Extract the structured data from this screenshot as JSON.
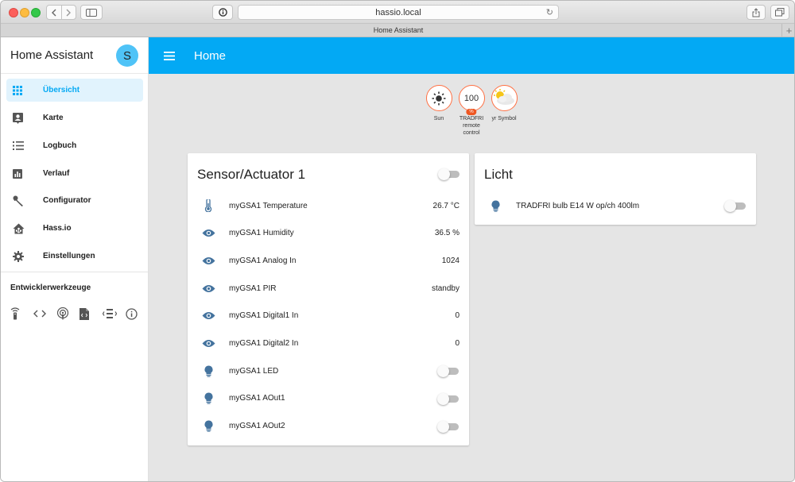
{
  "browser": {
    "url": "hassio.local",
    "tab_title": "Home Assistant"
  },
  "sidebar": {
    "title": "Home Assistant",
    "avatar_initial": "S",
    "items": [
      {
        "label": "Übersicht",
        "icon": "grid-icon",
        "active": true
      },
      {
        "label": "Karte",
        "icon": "map-account-icon"
      },
      {
        "label": "Logbuch",
        "icon": "list-icon"
      },
      {
        "label": "Verlauf",
        "icon": "chart-icon"
      },
      {
        "label": "Configurator",
        "icon": "wrench-icon"
      },
      {
        "label": "Hass.io",
        "icon": "home-assistant-icon"
      },
      {
        "label": "Einstellungen",
        "icon": "gear-icon"
      }
    ],
    "dev_tools_title": "Entwicklerwerkzeuge",
    "dev_tools": [
      "remote-icon",
      "code-icon",
      "podcast-icon",
      "file-xml-icon",
      "radio-tower-icon",
      "info-icon"
    ]
  },
  "header": {
    "title": "Home"
  },
  "badges": [
    {
      "label": "Sun",
      "value": "",
      "icon": "sun-icon"
    },
    {
      "label": "TRADFRI remote control",
      "value": "100",
      "unit": "%"
    },
    {
      "label": "yr Symbol",
      "value": "",
      "icon": "weather-icon"
    }
  ],
  "cards": {
    "sensor": {
      "title": "Sensor/Actuator 1",
      "rows": [
        {
          "name": "myGSA1 Temperature",
          "value": "26.7 °C",
          "icon": "thermometer-icon"
        },
        {
          "name": "myGSA1 Humidity",
          "value": "36.5 %",
          "icon": "eye-icon"
        },
        {
          "name": "myGSA1 Analog In",
          "value": "1024",
          "icon": "eye-icon"
        },
        {
          "name": "myGSA1 PIR",
          "value": "standby",
          "icon": "eye-icon"
        },
        {
          "name": "myGSA1 Digital1 In",
          "value": "0",
          "icon": "eye-icon"
        },
        {
          "name": "myGSA1 Digital2 In",
          "value": "0",
          "icon": "eye-icon"
        },
        {
          "name": "myGSA1 LED",
          "toggle": false,
          "icon": "lightbulb-icon"
        },
        {
          "name": "myGSA1 AOut1",
          "toggle": false,
          "icon": "lightbulb-icon"
        },
        {
          "name": "myGSA1 AOut2",
          "toggle": false,
          "icon": "lightbulb-icon"
        }
      ]
    },
    "light": {
      "title": "Licht",
      "rows": [
        {
          "name": "TRADFRI bulb E14 W op/ch 400lm",
          "toggle": false,
          "icon": "lightbulb-icon"
        }
      ]
    }
  },
  "colors": {
    "primary": "#03a9f4",
    "icon": "#44739e",
    "badge_border": "#ff7043"
  }
}
